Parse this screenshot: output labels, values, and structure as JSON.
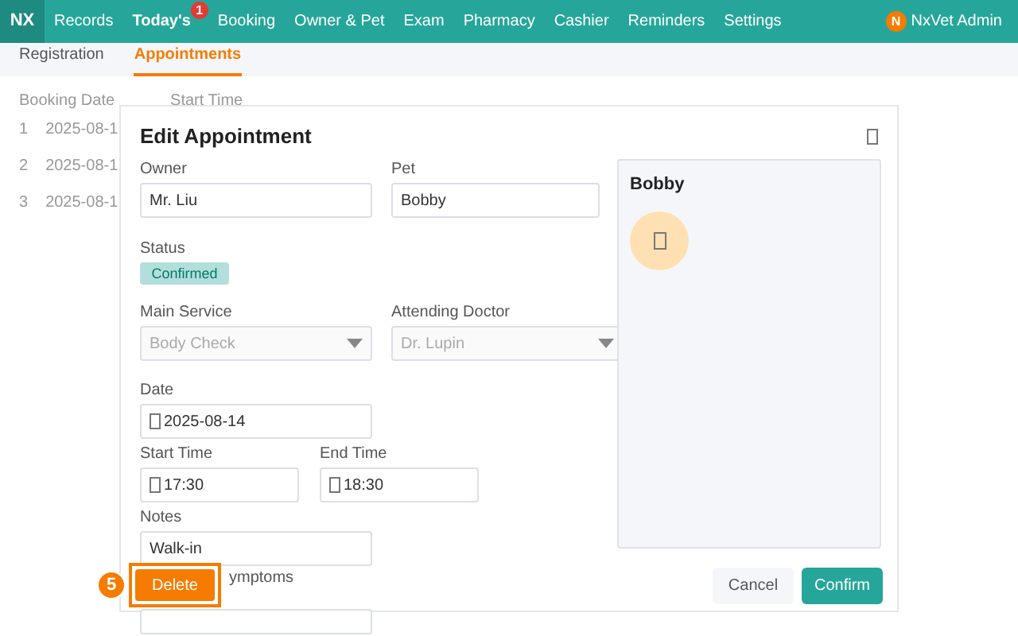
{
  "nav": {
    "logo": "NX",
    "items": [
      {
        "label": "Records",
        "selected": false
      },
      {
        "label": "Today's",
        "selected": true,
        "badge": "1"
      },
      {
        "label": "Booking",
        "selected": false
      },
      {
        "label": "Owner & Pet",
        "selected": false
      },
      {
        "label": "Exam",
        "selected": false
      },
      {
        "label": "Pharmacy",
        "selected": false
      },
      {
        "label": "Cashier",
        "selected": false
      },
      {
        "label": "Reminders",
        "selected": false
      },
      {
        "label": "Settings",
        "selected": false
      }
    ],
    "user": {
      "initial": "N",
      "name": "NxVet Admin"
    }
  },
  "tabs": [
    {
      "label": "Registration",
      "selected": false
    },
    {
      "label": "Appointments",
      "selected": true
    }
  ],
  "table": {
    "columns": [
      "Booking Date",
      "Start Time"
    ],
    "rows": [
      [
        "1",
        "2025-08-1"
      ],
      [
        "2",
        "2025-08-1"
      ],
      [
        "3",
        "2025-08-1"
      ]
    ]
  },
  "dialog": {
    "title": "Edit Appointment",
    "owner": {
      "label": "Owner",
      "value": "Mr. Liu"
    },
    "pet": {
      "label": "Pet",
      "value": "Bobby"
    },
    "status": {
      "label": "Status",
      "value": "Confirmed"
    },
    "main_service": {
      "label": "Main Service",
      "value": "Body Check",
      "disabled": true
    },
    "doctor": {
      "label": "Attending Doctor",
      "value": "Dr. Lupin",
      "disabled": true
    },
    "date": {
      "label": "Date",
      "value": "2025-08-14"
    },
    "start_time": {
      "label": "Start Time",
      "value": "17:30"
    },
    "end_time": {
      "label": "End Time",
      "value": "18:30"
    },
    "notes": {
      "label": "Notes",
      "value": "Walk-in"
    },
    "symptoms": {
      "label": "ymptoms"
    },
    "pet_card": {
      "name": "Bobby"
    },
    "buttons": {
      "cancel": "Cancel",
      "confirm": "Confirm",
      "delete": "Delete"
    },
    "step_badge": "5"
  }
}
